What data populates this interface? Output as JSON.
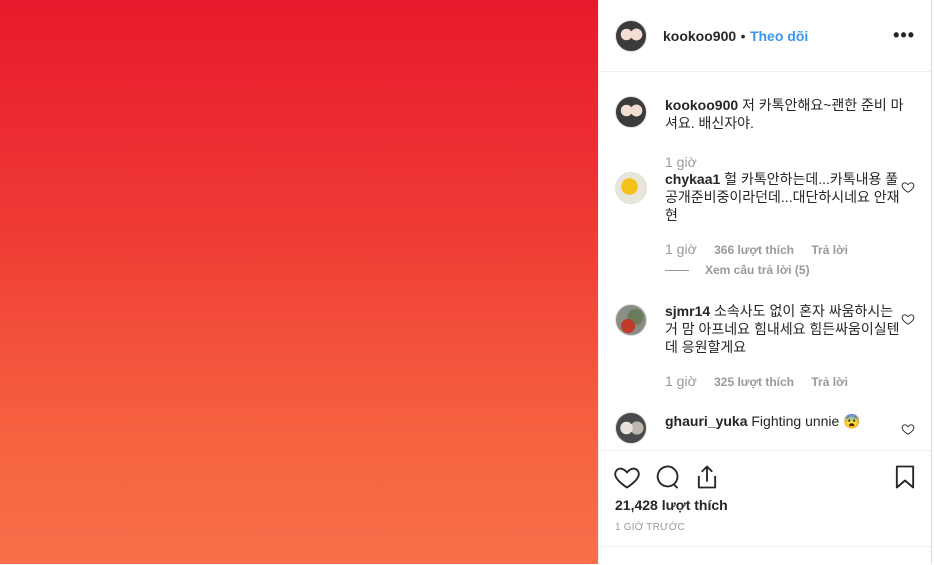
{
  "post": {
    "username": "kookoo900",
    "separator": "•",
    "follow_label": "Theo dõi",
    "more_label": "•••"
  },
  "comments": [
    {
      "username": "kookoo900",
      "text": "저 카톡안해요~괜한 준비 마셔요. 배신자야.",
      "time": "1 giờ",
      "likes": "",
      "reply": ""
    },
    {
      "username": "chykaa1",
      "text": "헐 카톡안하는데...카톡내용 풀공개준비중이라던데...대단하시네요 안재현",
      "time": "1 giờ",
      "likes": "366 lượt thích",
      "reply": "Trả lời",
      "view_replies": "Xem câu trả lời (5)"
    },
    {
      "username": "sjmr14",
      "text": "소속사도 없이 혼자 싸움하시는거 맘 아프네요 힘내세요 힘든싸움이실텐데 응원할게요",
      "time": "1 giờ",
      "likes": "325 lượt thích",
      "reply": "Trả lời"
    },
    {
      "username": "ghauri_yuka",
      "text": "Fighting unnie 😨",
      "time": "",
      "likes": "",
      "reply": ""
    }
  ],
  "footer": {
    "likes_label": "21,428 lượt thích",
    "timestamp": "1 GIỜ TRƯỚC"
  },
  "icons": {
    "heart": "heart-icon",
    "comment": "comment-icon",
    "share": "share-icon",
    "save": "bookmark-icon"
  },
  "colors": {
    "accent": "#3897f0",
    "media_top": "#e8192c",
    "media_bottom": "#f8704a",
    "muted": "#999999"
  }
}
